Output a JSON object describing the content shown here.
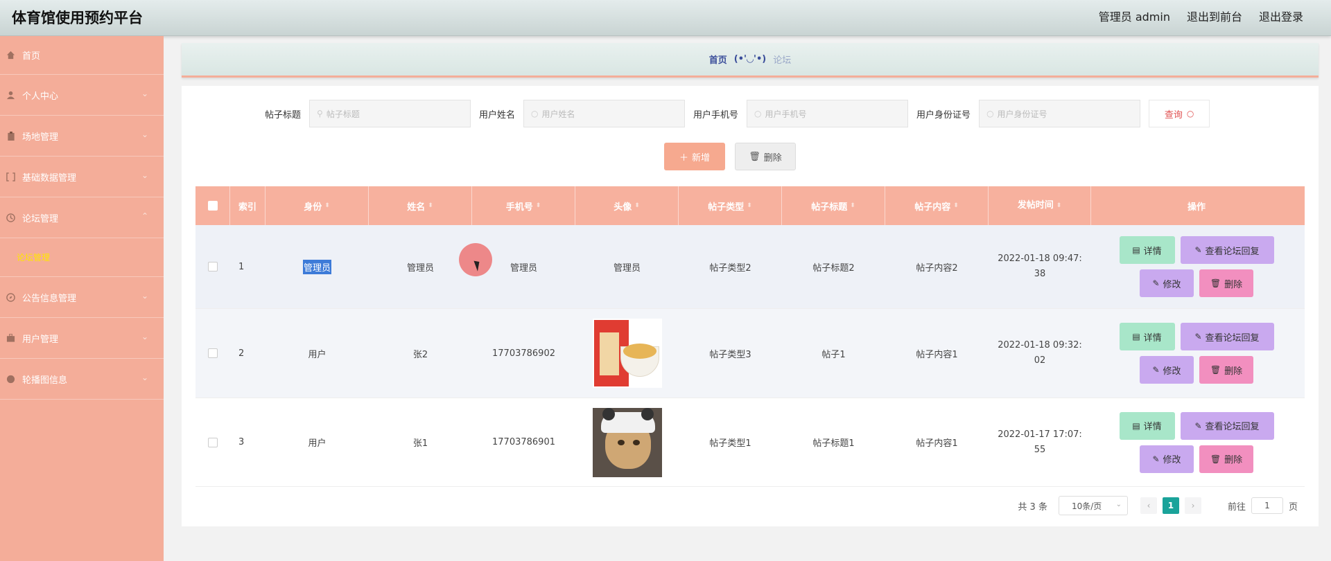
{
  "header": {
    "title": "体育馆使用预约平台",
    "user": "管理员 admin",
    "front_link": "退出到前台",
    "logout": "退出登录"
  },
  "sidebar": {
    "items": [
      {
        "label": "首页",
        "icon": "home-icon"
      },
      {
        "label": "个人中心",
        "icon": "user-icon"
      },
      {
        "label": "场地管理",
        "icon": "clipboard-icon"
      },
      {
        "label": "基础数据管理",
        "icon": "bracket-icon"
      },
      {
        "label": "论坛管理",
        "icon": "clock-icon"
      },
      {
        "label": "公告信息管理",
        "icon": "compass-icon"
      },
      {
        "label": "用户管理",
        "icon": "briefcase-icon"
      },
      {
        "label": "轮播图信息",
        "icon": "globe-icon"
      }
    ],
    "sub_item": "论坛管理"
  },
  "breadcrumb": {
    "home": "首页",
    "separator": "(•'◡'•)",
    "current": "论坛"
  },
  "search": {
    "fields": [
      {
        "label": "帖子标题",
        "placeholder": "帖子标题"
      },
      {
        "label": "用户姓名",
        "placeholder": "用户姓名"
      },
      {
        "label": "用户手机号",
        "placeholder": "用户手机号"
      },
      {
        "label": "用户身份证号",
        "placeholder": "用户身份证号"
      }
    ],
    "query_label": "查询"
  },
  "actions": {
    "add_label": "新增",
    "delete_label": "删除"
  },
  "table": {
    "headers": [
      "索引",
      "身份",
      "姓名",
      "手机号",
      "头像",
      "帖子类型",
      "帖子标题",
      "帖子内容",
      "发帖时间",
      "操作"
    ],
    "rows": [
      {
        "index": "1",
        "role": "管理员",
        "name": "管理员",
        "phone": "管理员",
        "avatar": "管理员",
        "type": "帖子类型2",
        "title": "帖子标题2",
        "content": "帖子内容2",
        "time_a": "2022-01-18 09:47:",
        "time_b": "38"
      },
      {
        "index": "2",
        "role": "用户",
        "name": "张2",
        "phone": "17703786902",
        "avatar": "",
        "type": "帖子类型3",
        "title": "帖子1",
        "content": "帖子内容1",
        "time_a": "2022-01-18 09:32:",
        "time_b": "02"
      },
      {
        "index": "3",
        "role": "用户",
        "name": "张1",
        "phone": "17703786901",
        "avatar": "",
        "type": "帖子类型1",
        "title": "帖子标题1",
        "content": "帖子内容1",
        "time_a": "2022-01-17 17:07:",
        "time_b": "55"
      }
    ],
    "op_labels": {
      "detail": "详情",
      "reply": "查看论坛回复",
      "edit": "修改",
      "remove": "删除"
    }
  },
  "pagination": {
    "total": "共 3 条",
    "page_size": "10条/页",
    "current_page": "1",
    "goto_label": "前往",
    "goto_value": "1",
    "page_unit": "页"
  },
  "colors": {
    "sidebar": "#f4ad99",
    "table_header": "#f7b19e",
    "detail_btn": "#a8e6c9",
    "reply_btn": "#c9a9ef",
    "delete_btn": "#f28fbf",
    "pager_active": "#1aa39a"
  }
}
